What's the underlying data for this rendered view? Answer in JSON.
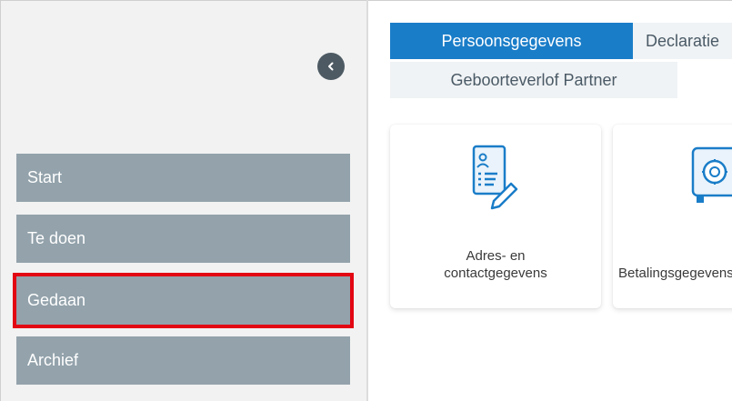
{
  "sidebar": {
    "collapse_icon": "chevron-left-icon",
    "items": [
      {
        "label": "Start"
      },
      {
        "label": "Te doen"
      },
      {
        "label": "Gedaan",
        "highlighted": true
      },
      {
        "label": "Archief"
      }
    ]
  },
  "tabs": [
    {
      "label": "Persoonsgegevens",
      "active": true
    },
    {
      "label": "Declaratie"
    },
    {
      "label": "Geboorteverlof Partner"
    }
  ],
  "cards": [
    {
      "line1": "Adres- en",
      "line2": "contactgegevens",
      "icon": "contact-form-edit-icon"
    },
    {
      "line1": "Betalingsgegevens",
      "icon": "safe-icon"
    }
  ],
  "colors": {
    "sidebar_bg": "#f2f2f2",
    "nav_item": "#93a2ab",
    "tab_active": "#1a7dc8",
    "tab_inactive": "#f0f3f5",
    "icon_blue": "#1a7dc8",
    "highlight": "#e30613"
  }
}
